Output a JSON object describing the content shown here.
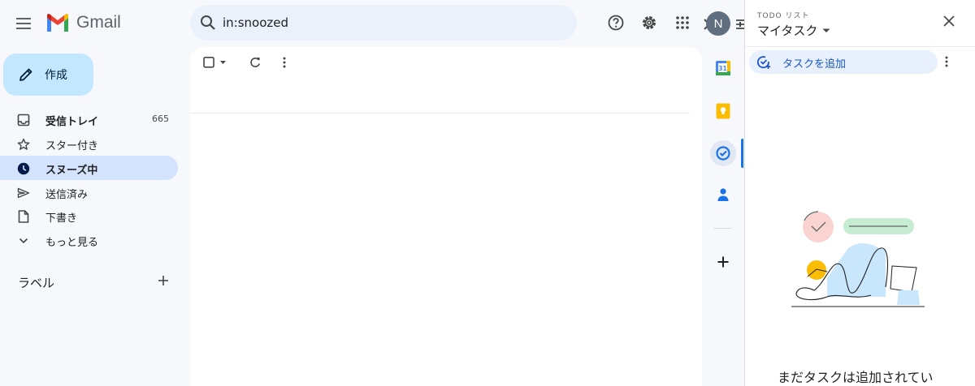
{
  "app": {
    "name": "Gmail"
  },
  "search": {
    "value": "in:snoozed"
  },
  "account": {
    "avatar_letter": "N"
  },
  "compose": {
    "label": "作成"
  },
  "nav": {
    "items": [
      {
        "label": "受信トレイ",
        "count": "665",
        "icon": "inbox-icon"
      },
      {
        "label": "スター付き",
        "count": "",
        "icon": "star-icon"
      },
      {
        "label": "スヌーズ中",
        "count": "",
        "icon": "clock-icon",
        "active": true
      },
      {
        "label": "送信済み",
        "count": "",
        "icon": "send-icon"
      },
      {
        "label": "下書き",
        "count": "",
        "icon": "draft-icon"
      },
      {
        "label": "もっと見る",
        "count": "",
        "icon": "chevron-down-icon"
      }
    ]
  },
  "labels": {
    "title": "ラベル"
  },
  "tasks": {
    "subtitle": "TODO リスト",
    "list_name": "マイタスク",
    "add_label": "タスクを追加",
    "empty_message": "まだタスクは追加されてい"
  },
  "rail": {
    "calendar_day": "31"
  },
  "colors": {
    "compose_bg": "#c2e7ff",
    "active_nav_bg": "#d3e3fd",
    "search_bg": "#eaf1fb",
    "accent_blue": "#1a73e8",
    "gmail_red": "#ea4335"
  }
}
